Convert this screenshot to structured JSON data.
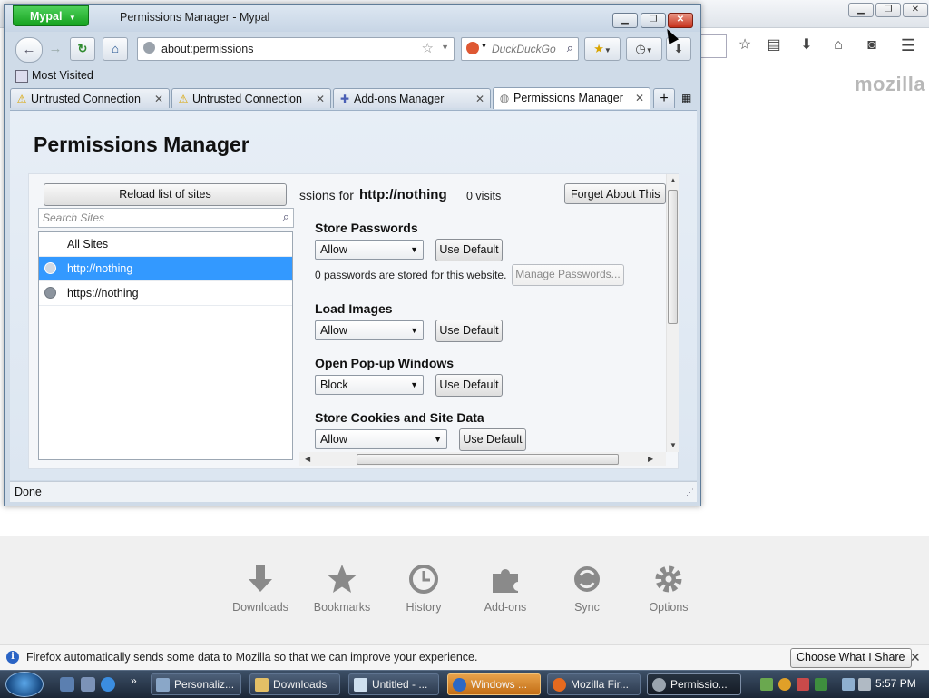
{
  "background_window": {
    "brand": "mozilla",
    "launchers": [
      {
        "label": "Downloads",
        "icon": "download-arrow-icon"
      },
      {
        "label": "Bookmarks",
        "icon": "star-icon"
      },
      {
        "label": "History",
        "icon": "clock-icon"
      },
      {
        "label": "Add-ons",
        "icon": "puzzle-icon"
      },
      {
        "label": "Sync",
        "icon": "sync-icon"
      },
      {
        "label": "Options",
        "icon": "gear-icon"
      }
    ]
  },
  "notification": {
    "text": "Firefox automatically sends some data to Mozilla so that we can improve your experience.",
    "button": "Choose What I Share",
    "close": "✕"
  },
  "window": {
    "app_button": "Mypal",
    "title": "Permissions Manager - Mypal",
    "url": "about:permissions",
    "search_placeholder": "DuckDuckGo",
    "bookmarks_toolbar": [
      "Most Visited"
    ],
    "tabs": [
      {
        "label": "Untrusted Connection",
        "icon": "warning-icon",
        "active": false
      },
      {
        "label": "Untrusted Connection",
        "icon": "warning-icon",
        "active": false
      },
      {
        "label": "Add-ons Manager",
        "icon": "puzzle-icon",
        "active": false
      },
      {
        "label": "Permissions Manager",
        "icon": "globe-icon",
        "active": true
      }
    ],
    "status": "Done"
  },
  "permissions_manager": {
    "heading": "Permissions Manager",
    "reload_button": "Reload list of sites",
    "search_placeholder": "Search Sites",
    "sites": [
      "All Sites",
      "http://nothing",
      "https://nothing"
    ],
    "selected_site": "http://nothing",
    "header_prefix": "ssions for",
    "host": "http://nothing",
    "visits": "0 visits",
    "forget_button": "Forget About This",
    "use_default_label": "Use Default",
    "passwords_note": "0 passwords are stored for this website.",
    "manage_passwords_button": "Manage Passwords...",
    "permissions": [
      {
        "title": "Store Passwords",
        "value": "Allow"
      },
      {
        "title": "Load Images",
        "value": "Allow"
      },
      {
        "title": "Open Pop-up Windows",
        "value": "Block"
      },
      {
        "title": "Store Cookies and Site Data",
        "value": "Allow"
      }
    ]
  },
  "taskbar": {
    "tasks": [
      {
        "label": "Personaliz...",
        "state": "normal"
      },
      {
        "label": "Downloads",
        "state": "normal"
      },
      {
        "label": "Untitled - ...",
        "state": "normal"
      },
      {
        "label": "Windows ...",
        "state": "flash"
      },
      {
        "label": "Mozilla Fir...",
        "state": "normal"
      },
      {
        "label": "Permissio...",
        "state": "active"
      }
    ],
    "clock": "5:57 PM"
  }
}
